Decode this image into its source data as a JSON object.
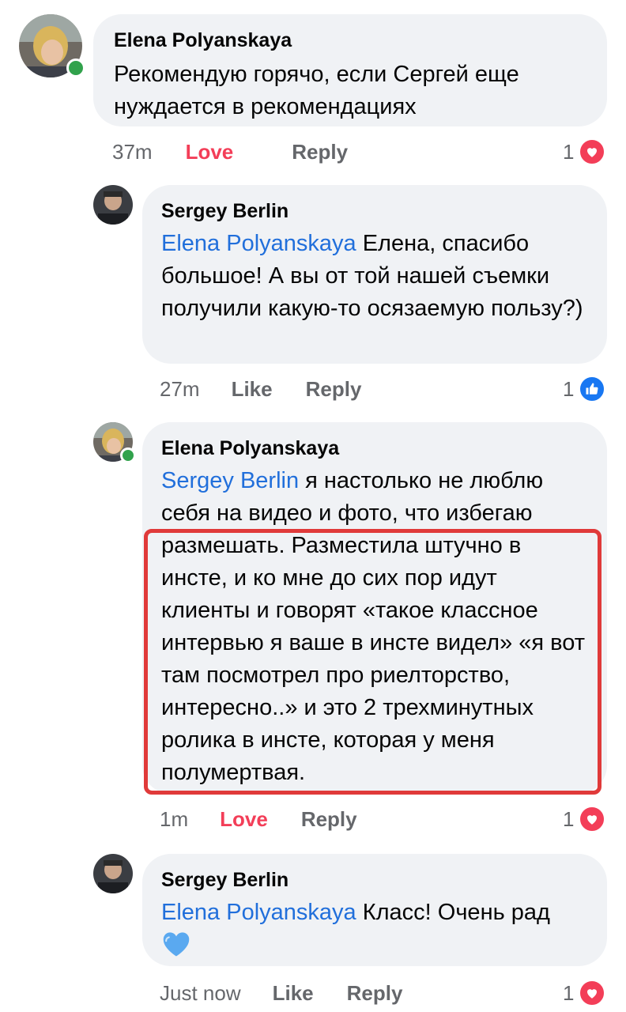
{
  "comments": [
    {
      "author": "Elena Polyanskaya",
      "text": "Рекомендую горячо, если Сергей еще нуждается в рекомендациях",
      "time": "37m",
      "reaction_label": "Love",
      "reply_label": "Reply",
      "reaction_count": "1",
      "reaction_icon": "heart-icon",
      "online": true
    },
    {
      "author": "Sergey Berlin",
      "mention": "Elena Polyanskaya",
      "text": " Елена, спасибо большое! А вы от той нашей съемки получили какую-то осязаемую пользу?)",
      "time": "27m",
      "reaction_label": "Like",
      "reply_label": "Reply",
      "reaction_count": "1",
      "reaction_icon": "like-icon"
    },
    {
      "author": "Elena Polyanskaya",
      "mention": "Sergey Berlin",
      "text_line1": " я настолько не люблю",
      "text_line2": "себя на видео и фото, что избегаю",
      "text_rest": "размешать. Разместила штучно в инсте, и ко мне до сих пор идут клиенты и говорят «такое классное интервью я ваше в инсте видел» «я вот там посмотрел про риелторство, интересно..» и это 2 трехминутных ролика в инсте, которая у меня полумертвая.",
      "time": "1m",
      "reaction_label": "Love",
      "reply_label": "Reply",
      "reaction_count": "1",
      "reaction_icon": "heart-icon"
    },
    {
      "author": "Sergey Berlin",
      "mention": "Elena Polyanskaya",
      "text": " Класс! Очень рад",
      "emoji": "💙",
      "time": "Just now",
      "reaction_label": "Like",
      "reply_label": "Reply",
      "reaction_count": "1",
      "reaction_icon": "heart-icon"
    }
  ],
  "colors": {
    "bubble": "#f0f2f5",
    "mention": "#216fdb",
    "love": "#f33e58",
    "like": "#1877f2",
    "highlight": "#e03a3a",
    "online": "#31a24c"
  }
}
